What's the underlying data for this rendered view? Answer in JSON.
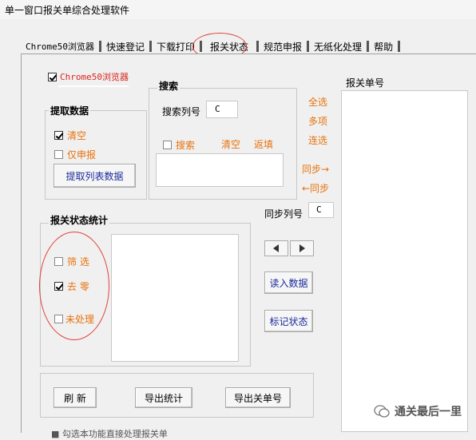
{
  "window": {
    "title": "单一窗口报关单综合处理软件"
  },
  "tabs": [
    {
      "label": "Chrome50浏览器"
    },
    {
      "label": "快速登记"
    },
    {
      "label": "下载打印"
    },
    {
      "label": "报关状态"
    },
    {
      "label": "规范申报"
    },
    {
      "label": "无纸化处理"
    },
    {
      "label": "帮助"
    }
  ],
  "active_tab": "报关状态",
  "browser_check": {
    "label": "Chrome50浏览器",
    "checked": true
  },
  "extract": {
    "title": "提取数据",
    "clear": {
      "label": "清空",
      "checked": true
    },
    "only_declare": {
      "label": "仅申报",
      "checked": false
    },
    "button": "提取列表数据"
  },
  "search": {
    "title": "搜索",
    "col_label": "搜索列号",
    "col_value": "C",
    "search_check": {
      "label": "搜索",
      "checked": false
    },
    "clear": "清空",
    "refill": "返填",
    "result": ""
  },
  "side_actions": {
    "select_all": "全选",
    "multi": "多项",
    "continuous": "连选",
    "sync_right": "同步→",
    "sync_left": "←同步"
  },
  "sync": {
    "label": "同步列号",
    "value": "C"
  },
  "status_stats": {
    "title": "报关状态统计",
    "filter": {
      "label": "筛 选",
      "checked": false
    },
    "remove_zero": {
      "label": "去 零",
      "checked": true
    },
    "unprocessed": {
      "label": "未处理",
      "checked": false
    },
    "content": ""
  },
  "nav": {
    "left_icon": "left-triangle-icon",
    "right_icon": "right-triangle-icon"
  },
  "buttons": {
    "read_data": "读入数据",
    "mark_status": "标记状态",
    "refresh": "刷 新",
    "export_stats": "导出统计",
    "export_numbers": "导出关单号"
  },
  "right_panel": {
    "title": "报关单号"
  },
  "watermark": {
    "text": "通关最后一里"
  },
  "bottom_cut_text": "■ 勾选本功能直接处理报关单"
}
